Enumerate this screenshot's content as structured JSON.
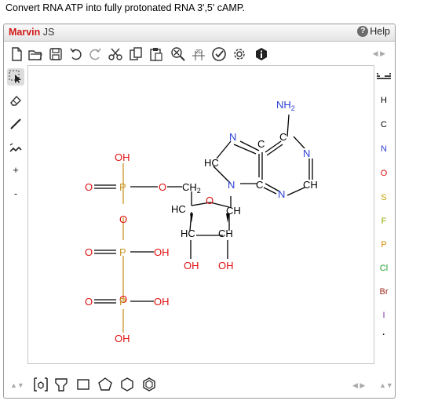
{
  "prompt": "Convert RNA ATP into fully protonated RNA 3',5' cAMP.",
  "app": {
    "brand_main": "Marvin",
    "brand_sub": " JS",
    "help_label": "Help"
  },
  "toolbar": {
    "icons": [
      "new-document-icon",
      "open-icon",
      "save-icon",
      "undo-icon",
      "redo-icon",
      "cut-icon",
      "copy-icon",
      "paste-icon",
      "zoom-icon",
      "2d-clean-icon",
      "checkmark-icon",
      "settings-icon",
      "info-icon"
    ],
    "clean_label": "2D"
  },
  "left_tools": [
    "select-tool",
    "erase-tool",
    "bond-tool",
    "chain-tool",
    "charge-plus",
    "charge-minus"
  ],
  "plus_label": "+",
  "minus_label": "-",
  "periodic_label": "periodic-table-icon",
  "elements": [
    "H",
    "C",
    "N",
    "O",
    "S",
    "F",
    "P",
    "Cl",
    "Br",
    "I",
    "·"
  ],
  "element_colors": {
    "H": "#222222",
    "C": "#222222",
    "N": "#2d3fd6",
    "O": "#e01010",
    "S": "#c7a200",
    "F": "#8bb000",
    "P": "#d98a00",
    "Cl": "#1d9e2a",
    "Br": "#9c2a1d",
    "I": "#7a2fa0",
    "·": "#222222"
  },
  "molecule": {
    "oh_top": "OH",
    "o1": "O",
    "p1": "P",
    "o_link": "O",
    "ch2": "CH",
    "ch2_sub": "2",
    "hc_ring1": "HC",
    "o_ring": "O",
    "ch_ring1": "CH",
    "hc_ring2": "HC",
    "ch_ring2": "CH",
    "oh_2a": "OH",
    "oh_2b": "OH",
    "o2": "O",
    "p2": "P",
    "oh_p2": "OH",
    "o_bridge": "O",
    "o3": "O",
    "p3": "P",
    "oh_p3": "OH",
    "oh_bottom": "OH",
    "nh2": "NH",
    "nh2_sub": "2",
    "n_a": "N",
    "c_a": "C",
    "hc_a": "HC",
    "n_b": "N",
    "c_b": "C",
    "n_c": "N",
    "c_c": "C",
    "n_d": "N",
    "ch_d": "CH"
  },
  "bottom": {
    "templates": [
      "pyridine-tool",
      "benzene-bracket-icon",
      "template-icon",
      "square-icon",
      "pentagon-icon",
      "hexagon-icon",
      "hexagon-aromatic-icon"
    ]
  }
}
